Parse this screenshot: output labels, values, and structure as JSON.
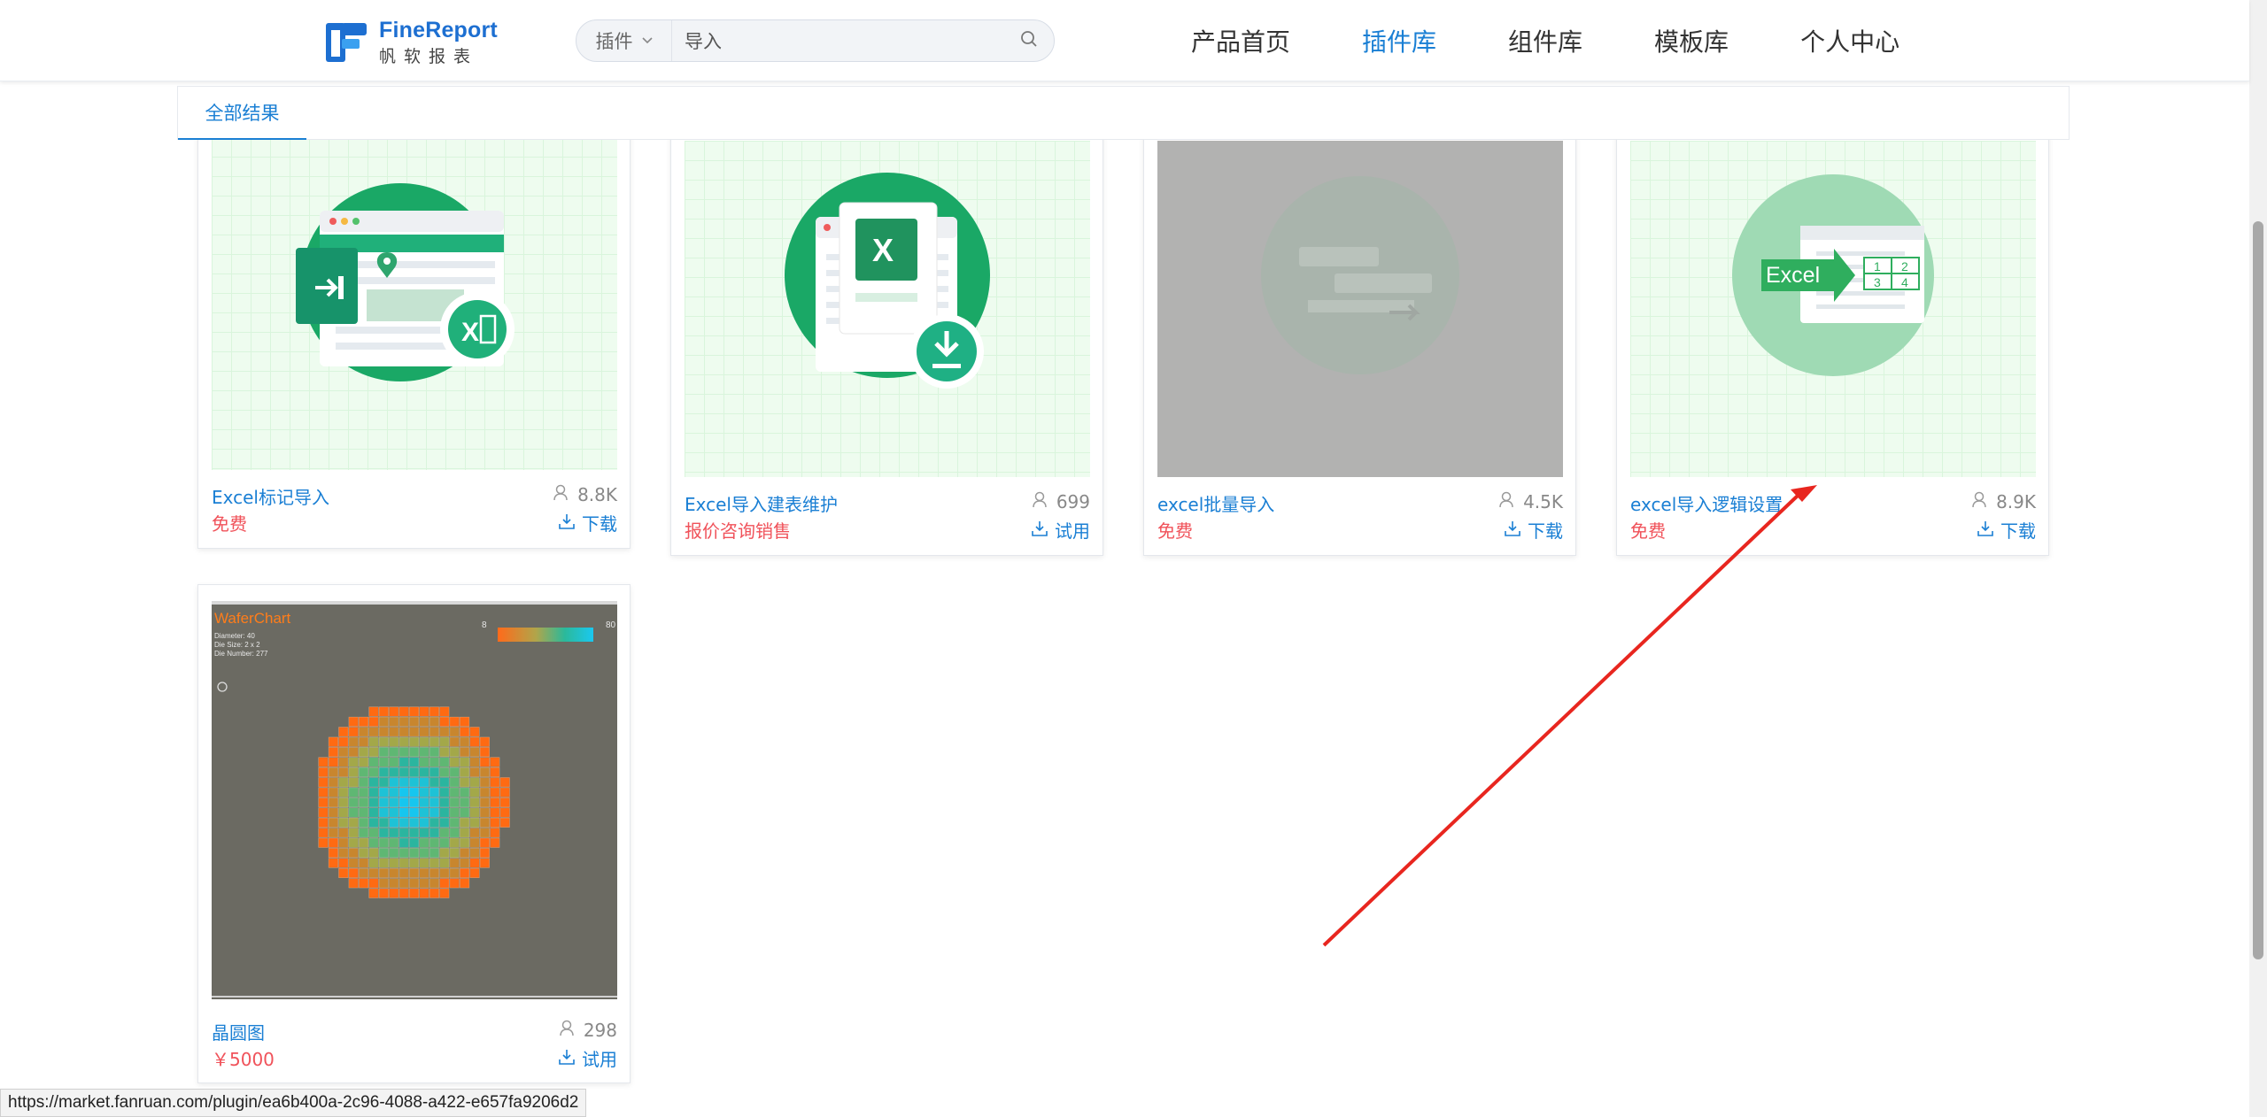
{
  "header": {
    "logo": {
      "en": "FineReport",
      "cn": "帆软报表"
    },
    "search": {
      "type_label": "插件",
      "value": "导入"
    },
    "nav": [
      {
        "label": "产品首页",
        "active": false
      },
      {
        "label": "插件库",
        "active": true
      },
      {
        "label": "组件库",
        "active": false
      },
      {
        "label": "模板库",
        "active": false
      },
      {
        "label": "个人中心",
        "active": false
      }
    ]
  },
  "tabs": {
    "all_results": "全部结果"
  },
  "cards": [
    {
      "name": "Excel标记导入",
      "price": "免费",
      "count": "8.8K",
      "action": "下载"
    },
    {
      "name": "Excel导入建表维护",
      "price": "报价咨询销售",
      "count": "699",
      "action": "试用"
    },
    {
      "name": "excel批量导入",
      "price": "免费",
      "count": "4.5K",
      "action": "下载"
    },
    {
      "name": "excel导入逻辑设置",
      "price": "免费",
      "count": "8.9K",
      "action": "下载"
    },
    {
      "name": "晶圆图",
      "price": "￥5000",
      "count": "298",
      "action": "试用"
    }
  ],
  "thumbs": {
    "excel_badge": "Excel",
    "excel_grid": [
      "1",
      "2",
      "3",
      "4"
    ],
    "x_letter": "X",
    "wafer": {
      "title": "WaferChart",
      "info": [
        "Diameter:  40",
        "Die Size:  2 x 2",
        "Die Number: 277"
      ],
      "scale_min": "8",
      "scale_max": "80"
    }
  },
  "status_url": "https://market.fanruan.com/plugin/ea6b400a-2c96-4088-a422-e657fa9206d2",
  "colors": {
    "accent": "#1a7fd4",
    "price": "#f0525a",
    "annotation_arrow": "#e8261f"
  }
}
